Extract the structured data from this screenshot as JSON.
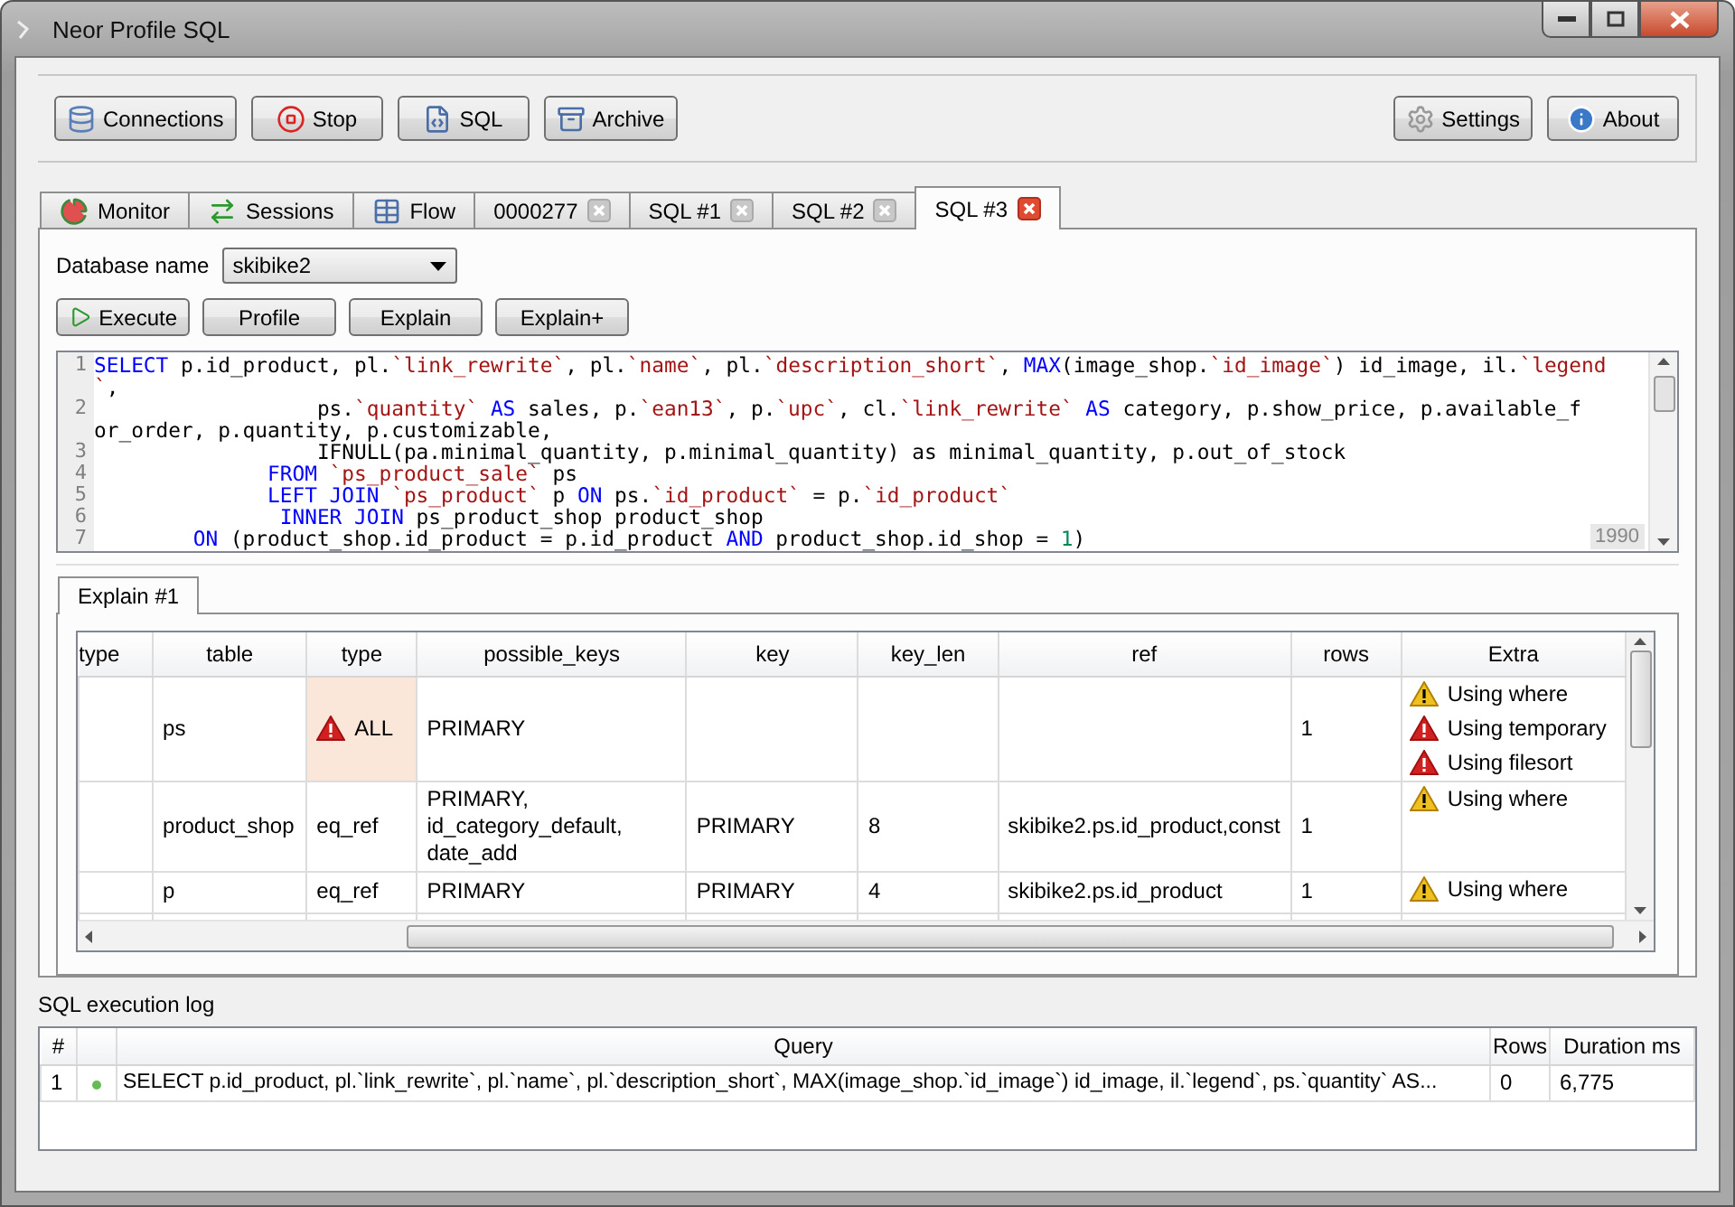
{
  "window": {
    "title": "Neor Profile SQL"
  },
  "toolbar": {
    "left": [
      {
        "label": "Connections"
      },
      {
        "label": "Stop"
      },
      {
        "label": "SQL"
      },
      {
        "label": "Archive"
      }
    ],
    "right": [
      {
        "label": "Settings"
      },
      {
        "label": "About"
      }
    ]
  },
  "tabs": [
    {
      "label": "Monitor",
      "closable": false,
      "selected": false
    },
    {
      "label": "Sessions",
      "closable": false,
      "selected": false
    },
    {
      "label": "Flow",
      "closable": false,
      "selected": false
    },
    {
      "label": "0000277",
      "closable": true,
      "selected": false
    },
    {
      "label": "SQL #1",
      "closable": true,
      "selected": false
    },
    {
      "label": "SQL #2",
      "closable": true,
      "selected": false
    },
    {
      "label": "SQL #3",
      "closable": true,
      "selected": true
    }
  ],
  "database": {
    "label": "Database name",
    "value": "skibike2"
  },
  "actions": [
    {
      "label": "Execute"
    },
    {
      "label": "Profile"
    },
    {
      "label": "Explain"
    },
    {
      "label": "Explain+"
    }
  ],
  "editor": {
    "badge": "1990",
    "lines": [
      {
        "number": "1",
        "tokens": [
          {
            "kind": "keyword",
            "text": "SELECT"
          },
          {
            "kind": "plain",
            "text": " p.id_product, pl."
          },
          {
            "kind": "string",
            "text": "`link_rewrite`"
          },
          {
            "kind": "plain",
            "text": ", pl."
          },
          {
            "kind": "string",
            "text": "`name`"
          },
          {
            "kind": "plain",
            "text": ", pl."
          },
          {
            "kind": "string",
            "text": "`description_short`"
          },
          {
            "kind": "plain",
            "text": ", "
          },
          {
            "kind": "keyword",
            "text": "MAX"
          },
          {
            "kind": "plain",
            "text": "(image_shop."
          },
          {
            "kind": "string",
            "text": "`id_image`"
          },
          {
            "kind": "plain",
            "text": ") id_image, il."
          },
          {
            "kind": "string",
            "text": "`legend"
          }
        ]
      },
      {
        "tokens": [
          {
            "kind": "string",
            "text": "`"
          },
          {
            "kind": "plain",
            "text": ","
          }
        ]
      },
      {
        "number": "2",
        "tokens": [
          {
            "kind": "plain",
            "text": "                  ps."
          },
          {
            "kind": "string",
            "text": "`quantity`"
          },
          {
            "kind": "keyword",
            "text": " AS"
          },
          {
            "kind": "plain",
            "text": " sales, p."
          },
          {
            "kind": "string",
            "text": "`ean13`"
          },
          {
            "kind": "plain",
            "text": ", p."
          },
          {
            "kind": "string",
            "text": "`upc`"
          },
          {
            "kind": "plain",
            "text": ", cl."
          },
          {
            "kind": "string",
            "text": "`link_rewrite`"
          },
          {
            "kind": "keyword",
            "text": " AS"
          },
          {
            "kind": "plain",
            "text": " category, p.show_price, p.available_f"
          }
        ]
      },
      {
        "tokens": [
          {
            "kind": "plain",
            "text": "or_order, p.quantity, p.customizable,"
          }
        ]
      },
      {
        "number": "3",
        "tokens": [
          {
            "kind": "plain",
            "text": "                  IFNULL(pa.minimal_quantity, p.minimal_quantity) as minimal_quantity, p.out_of_stock"
          }
        ]
      },
      {
        "number": "4",
        "tokens": [
          {
            "kind": "keyword",
            "text": "              FROM"
          },
          {
            "kind": "string",
            "text": " `ps_product_sale`"
          },
          {
            "kind": "plain",
            "text": " ps"
          }
        ]
      },
      {
        "number": "5",
        "tokens": [
          {
            "kind": "keyword",
            "text": "              LEFT JOIN"
          },
          {
            "kind": "string",
            "text": " `ps_product`"
          },
          {
            "kind": "plain",
            "text": " p "
          },
          {
            "kind": "keyword",
            "text": "ON"
          },
          {
            "kind": "plain",
            "text": " ps."
          },
          {
            "kind": "string",
            "text": "`id_product`"
          },
          {
            "kind": "plain",
            "text": " = p."
          },
          {
            "kind": "string",
            "text": "`id_product`"
          }
        ]
      },
      {
        "number": "6",
        "tokens": [
          {
            "kind": "keyword",
            "text": "               INNER JOIN"
          },
          {
            "kind": "plain",
            "text": " ps_product_shop product_shop"
          }
        ]
      },
      {
        "number": "7",
        "tokens": [
          {
            "kind": "keyword",
            "text": "        ON"
          },
          {
            "kind": "plain",
            "text": " (product_shop.id_product = p.id_product "
          },
          {
            "kind": "keyword",
            "text": "AND"
          },
          {
            "kind": "plain",
            "text": " product_shop.id_shop = "
          },
          {
            "kind": "number",
            "text": "1"
          },
          {
            "kind": "plain",
            "text": ")"
          }
        ]
      }
    ]
  },
  "explain": {
    "tab": "Explain #1",
    "columns": [
      "type",
      "table",
      "type",
      "possible_keys",
      "key",
      "key_len",
      "ref",
      "rows",
      "Extra"
    ],
    "rows": [
      {
        "cells": [
          "",
          "ps",
          "ALL",
          "PRIMARY",
          "",
          "",
          "",
          "1"
        ],
        "type_alert": true,
        "extra": [
          {
            "kind": "warning",
            "text": "Using where"
          },
          {
            "kind": "error",
            "text": "Using temporary"
          },
          {
            "kind": "error",
            "text": "Using filesort"
          }
        ]
      },
      {
        "cells": [
          "",
          "product_shop",
          "eq_ref",
          "PRIMARY, id_category_default, date_add",
          "PRIMARY",
          "8",
          "skibike2.ps.id_product,const",
          "1"
        ],
        "type_alert": false,
        "extra": [
          {
            "kind": "warning",
            "text": "Using where"
          }
        ]
      },
      {
        "cells": [
          "",
          "p",
          "eq_ref",
          "PRIMARY",
          "PRIMARY",
          "4",
          "skibike2.ps.id_product",
          "1"
        ],
        "type_alert": false,
        "extra": [
          {
            "kind": "warning",
            "text": "Using where"
          }
        ]
      }
    ]
  },
  "log": {
    "title": "SQL execution log",
    "columns": [
      "#",
      "",
      "Query",
      "Rows",
      "Duration ms"
    ],
    "rows": [
      {
        "number": "1",
        "color": "#66bb55",
        "query": "SELECT p.id_product, pl.`link_rewrite`, pl.`name`, pl.`description_short`, MAX(image_shop.`id_image`) id_image, il.`legend`, ps.`quantity` AS...",
        "rows": "0",
        "duration": "6,775"
      }
    ]
  }
}
